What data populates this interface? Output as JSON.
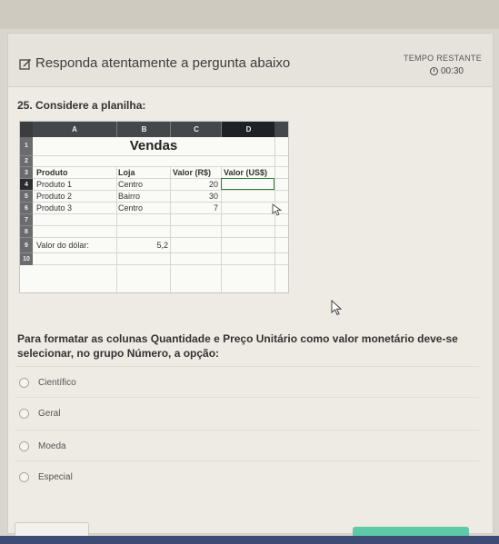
{
  "header": {
    "title": "Responda atentamente a pergunta abaixo",
    "timer_label": "TEMPO RESTANTE",
    "timer_value": "00:30",
    "icon": "edit-icon"
  },
  "question": {
    "title": "25.  Considere a planilha:",
    "text": "Para formatar as colunas Quantidade e Preço Unitário como valor monetário deve-se selecionar, no grupo Número, a opção:"
  },
  "spreadsheet": {
    "columns": [
      "A",
      "B",
      "C",
      "D"
    ],
    "rows": [
      "1",
      "2",
      "3",
      "4",
      "5",
      "6",
      "7",
      "8",
      "9",
      "10"
    ],
    "title": "Vendas",
    "headers": [
      "Produto",
      "Loja",
      "Valor (R$)",
      "Valor (US$)"
    ],
    "data": [
      [
        "Produto 1",
        "Centro",
        "20",
        ""
      ],
      [
        "Produto 2",
        "Bairro",
        "30",
        ""
      ],
      [
        "Produto 3",
        "Centro",
        "7",
        ""
      ]
    ],
    "dollar_label": "Valor do dólar:",
    "dollar_value": "5,2"
  },
  "options": [
    {
      "label": "Científico"
    },
    {
      "label": "Geral"
    },
    {
      "label": "Moeda"
    },
    {
      "label": "Especial"
    }
  ],
  "colors": {
    "accent_button": "#5ec9a7",
    "bottom_bar": "#3e4c73",
    "selection": "#2f7d3a"
  }
}
